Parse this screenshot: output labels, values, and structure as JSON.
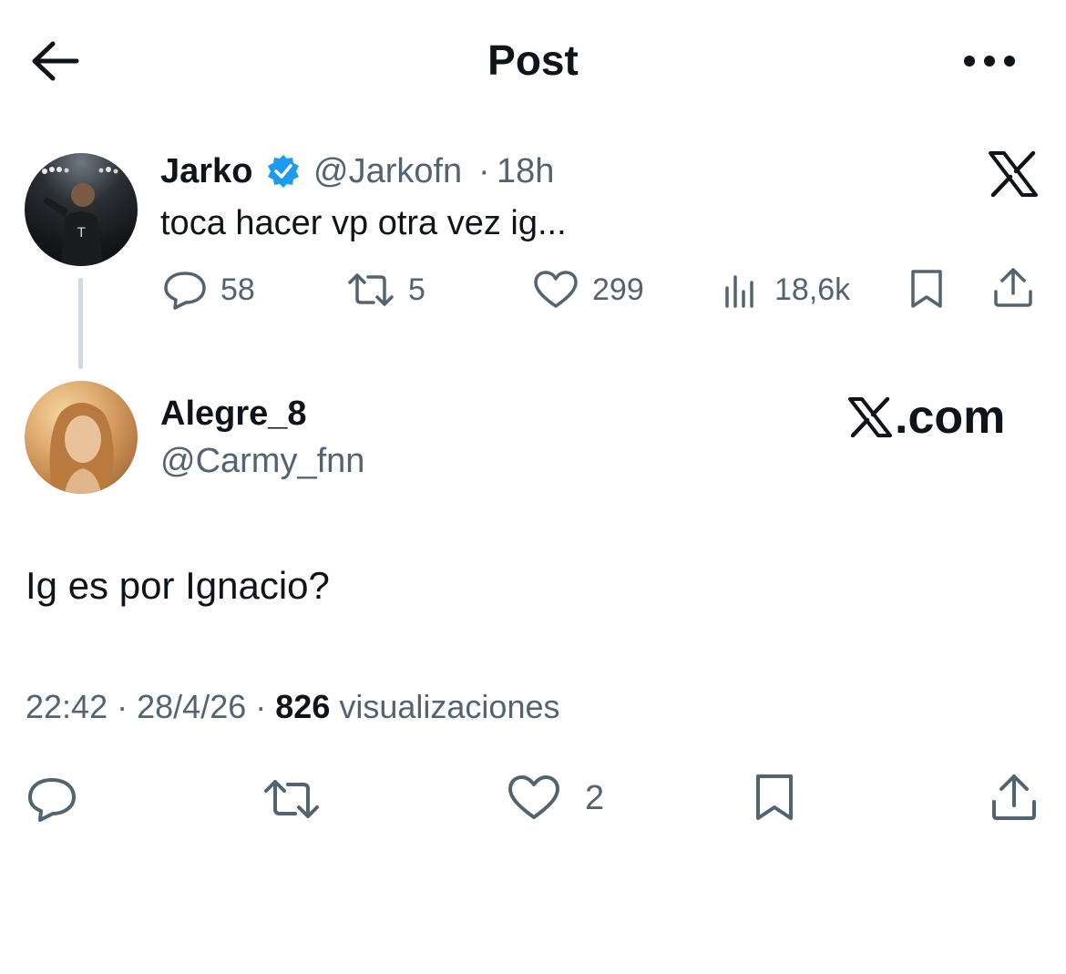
{
  "header": {
    "title": "Post",
    "back_icon": "arrow-left-icon",
    "more_icon": "more-horizontal-icon"
  },
  "parent_tweet": {
    "author_name": "Jarko",
    "verified": true,
    "handle": "@Jarkofn",
    "separator": "·",
    "time": "18h",
    "text": "toca hacer vp otra vez ig...",
    "platform_icon": "x-logo-icon",
    "stats": {
      "replies": "58",
      "reposts": "5",
      "likes": "299",
      "views": "18,6k"
    }
  },
  "reply_tweet": {
    "author_name": "Alegre_8",
    "handle": "@Carmy_fnn",
    "watermark": ".com",
    "text": "Ig es por Ignacio?",
    "meta": {
      "time": "22:42",
      "separator": "·",
      "date": "28/4/26",
      "views_count": "826",
      "views_label": "visualizaciones"
    },
    "stats": {
      "likes": "2"
    }
  },
  "colors": {
    "text": "#0f1419",
    "muted": "#536471",
    "verified": "#1d9bf0",
    "thread_line": "#cfd9de"
  }
}
